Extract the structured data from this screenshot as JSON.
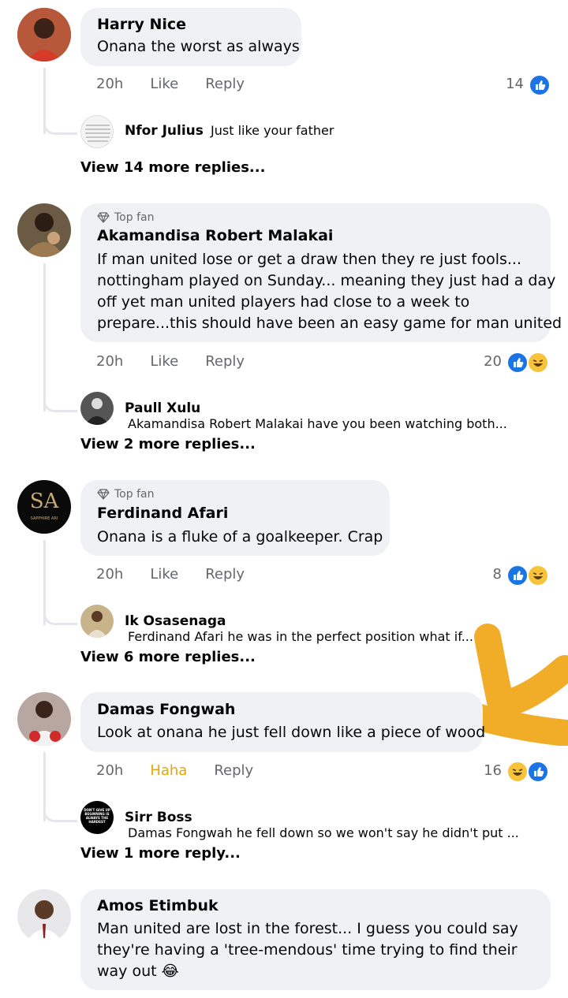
{
  "comments": [
    {
      "name": "Harry Nice",
      "text": "Onana the worst as always",
      "time": "20h",
      "like": "Like",
      "reply": "Reply",
      "count": "14",
      "reply_preview": {
        "name": "Nfor Julius",
        "text": "Just like your father"
      },
      "more": "View 14 more replies..."
    },
    {
      "badge": "Top fan",
      "name": "Akamandisa Robert Malakai",
      "text_lines": [
        "If man united lose or get a draw then they re just fools...",
        "nottingham played on Sunday... meaning they just had a day",
        "off yet man united players had close to a week to",
        "prepare...this should have been an easy game for man united"
      ],
      "time": "20h",
      "like": "Like",
      "reply": "Reply",
      "count": "20",
      "reply_preview": {
        "name": "Paull Xulu",
        "text": "Akamandisa Robert Malakai have you been watching both..."
      },
      "more": "View 2 more replies..."
    },
    {
      "badge": "Top fan",
      "name": "Ferdinand Afari",
      "text": "Onana is a fluke of a goalkeeper. Crap",
      "avatar_text": "SA",
      "avatar_sub": "SAPPHIRE ARI",
      "time": "20h",
      "like": "Like",
      "reply": "Reply",
      "count": "8",
      "reply_preview": {
        "name": "Ik Osasenaga",
        "text": "Ferdinand Afari he was in the perfect position what if..."
      },
      "more": "View 6 more replies..."
    },
    {
      "name": "Damas Fongwah",
      "text": "Look at onana he just fell down like a piece of wood",
      "time": "20h",
      "like": "Haha",
      "reply": "Reply",
      "count": "16",
      "reply_preview": {
        "name": "Sirr Boss",
        "text": "Damas Fongwah he fell down so we won't say he didn't put ...",
        "avatar_text": "DON'T GIVE UP BEGINNING IS ALWAYS THE HARDEST"
      },
      "more": "View 1 more reply..."
    },
    {
      "name": "Amos Etimbuk",
      "text_lines": [
        "Man united are lost in the forest... I guess you could say",
        "they're having a 'tree-mendous' time trying to find their",
        "way out 😂"
      ]
    }
  ],
  "colors": {
    "like_blue": "#1b74e4",
    "haha_yellow": "#f7c33b",
    "haha_text": "#e5a50a",
    "bubble": "#eff1f4",
    "meta": "#65676b",
    "marker": "#f0a81c"
  }
}
